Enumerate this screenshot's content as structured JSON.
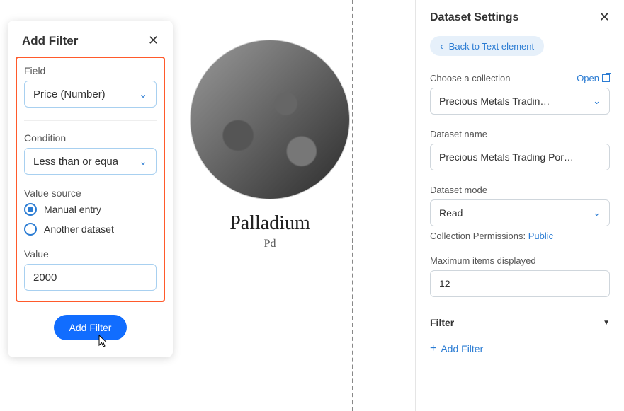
{
  "addFilter": {
    "title": "Add Filter",
    "fieldLabel": "Field",
    "fieldValue": "Price (Number)",
    "conditionLabel": "Condition",
    "conditionValue": "Less than or equa",
    "valueSourceLabel": "Value source",
    "radioManual": "Manual entry",
    "radioAnother": "Another dataset",
    "valueLabel": "Value",
    "valueInput": "2000",
    "submit": "Add Filter"
  },
  "preview": {
    "title": "Palladium",
    "sub": "Pd"
  },
  "settings": {
    "title": "Dataset Settings",
    "back": "Back to Text element",
    "chooseCollection": "Choose a collection",
    "open": "Open",
    "collectionValue": "Precious Metals Tradin…",
    "datasetNameLabel": "Dataset name",
    "datasetNameValue": "Precious Metals Trading Por…",
    "datasetModeLabel": "Dataset mode",
    "datasetModeValue": "Read",
    "permLabel": "Collection Permissions: ",
    "permValue": "Public",
    "maxItemsLabel": "Maximum items displayed",
    "maxItemsValue": "12",
    "filterHeader": "Filter",
    "addFilterLink": "Add Filter"
  }
}
